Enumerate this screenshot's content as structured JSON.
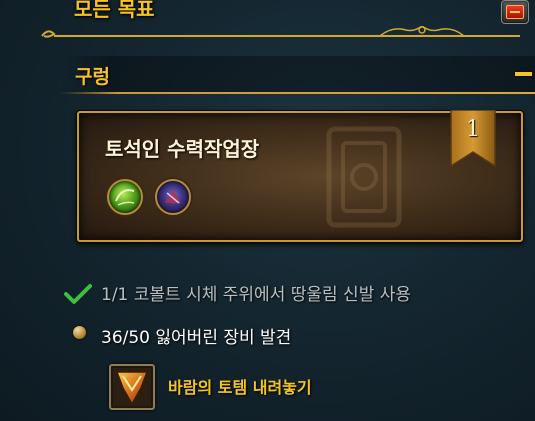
{
  "header": {
    "title": "모든 목표"
  },
  "zone": {
    "name": "구렁"
  },
  "quest": {
    "title": "토석인 수력작업장",
    "level": "1",
    "rewards": [
      {
        "icon": "green-orb-icon"
      },
      {
        "icon": "purple-crystal-icon"
      }
    ]
  },
  "objectives": [
    {
      "text": "1/1 코볼트 시체 주위에서 땅울림 신발 사용",
      "status": "complete"
    },
    {
      "text": "36/50 잃어버린 장비 발견",
      "status": "in-progress"
    }
  ],
  "action_item": {
    "label": "바람의 토템 내려놓기",
    "icon": "totem-icon"
  },
  "colors": {
    "gold": "#f5c423",
    "complete_check": "#3fbf3f",
    "card_border": "#c59a39"
  }
}
